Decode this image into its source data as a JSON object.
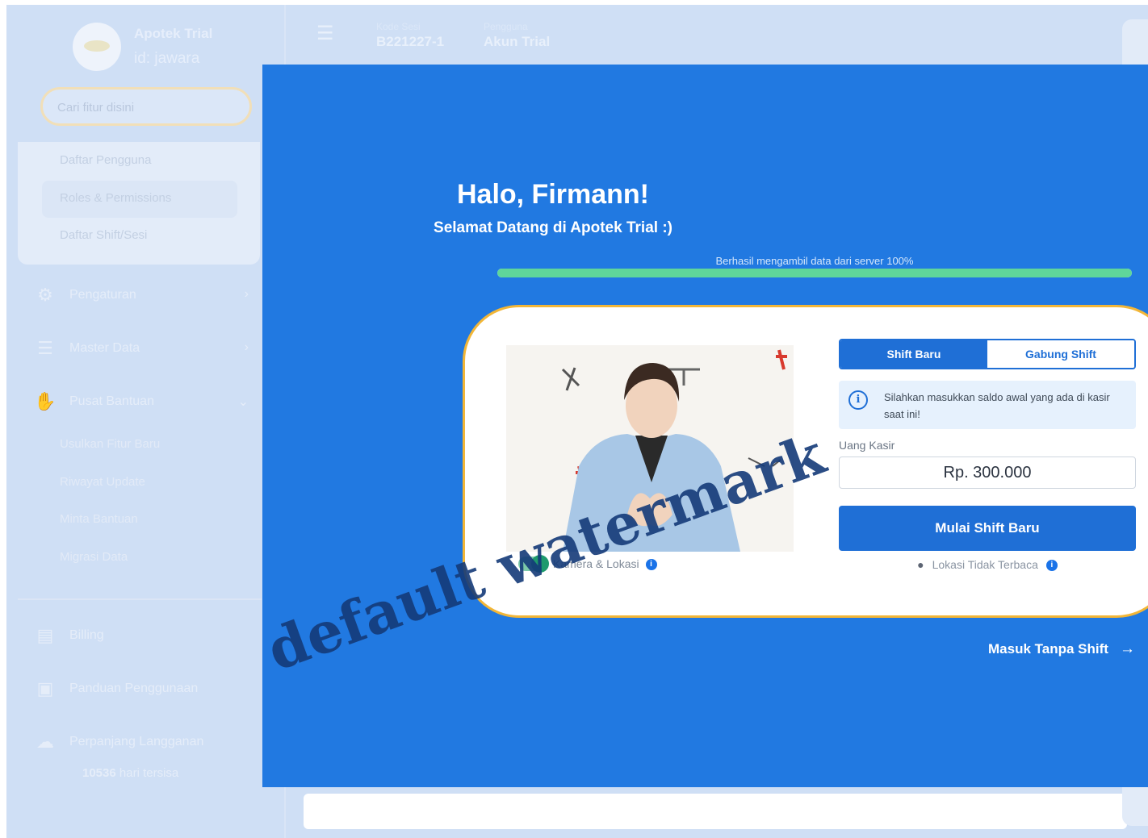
{
  "app": {
    "name": "Apotek Trial",
    "id": "id: jawara"
  },
  "search": {
    "placeholder": "Cari fitur disini"
  },
  "sidebar": {
    "submenu": [
      "Daftar Pengguna",
      "Roles & Permissions",
      "Daftar Shift/Sesi"
    ],
    "nav": [
      {
        "label": "Pengaturan",
        "icon": "gear-icon"
      },
      {
        "label": "Master Data",
        "icon": "database-icon"
      },
      {
        "label": "Pusat Bantuan",
        "icon": "handshake-icon"
      }
    ],
    "help_items": [
      "Usulkan Fitur Baru",
      "Riwayat Update",
      "Minta Bantuan",
      "Migrasi Data"
    ],
    "bottom": [
      {
        "label": "Billing",
        "icon": "receipt-icon"
      },
      {
        "label": "Panduan Penggunaan",
        "icon": "book-icon"
      },
      {
        "label": "Perpanjang Langganan",
        "icon": "cloud-upload-icon"
      }
    ],
    "days_left_number": "10536",
    "days_left_suffix": "hari tersisa"
  },
  "topbar": {
    "session_label": "Kode Sesi",
    "session_value": "B221227-1",
    "user_label": "Pengguna",
    "user_value": "Akun Trial"
  },
  "welcome": {
    "title": "Halo, Firmann!",
    "subtitle": "Selamat Datang di Apotek Trial :)",
    "progress_text": "Berhasil mengambil data dari server 100%",
    "progress": 1.0
  },
  "shift_card": {
    "camera_label": "Kamera & Lokasi",
    "tabs": [
      "Shift Baru",
      "Gabung Shift"
    ],
    "active_tab": "Shift Baru",
    "alert": "Silahkan masukkan saldo awal yang ada di kasir saat ini!",
    "cash_label": "Uang Kasir",
    "cash_value": "Rp. 300.000",
    "start_button": "Mulai Shift Baru",
    "location_status": "Lokasi Tidak Terbaca"
  },
  "enter_without_shift": "Masuk Tanpa Shift",
  "watermark": "default watermark",
  "colors": {
    "overlay": "#2179e1",
    "primary": "#1f6fd6",
    "card_border": "#f2b637",
    "progress": "#5fd69a"
  }
}
